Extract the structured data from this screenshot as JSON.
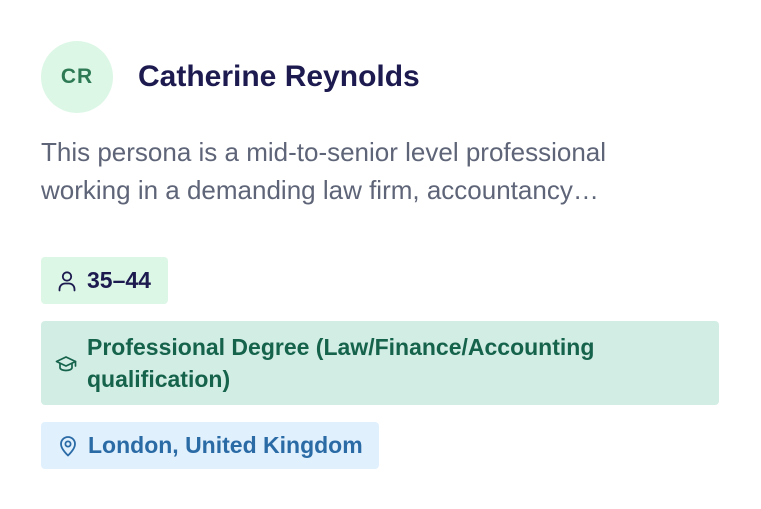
{
  "persona": {
    "initials": "CR",
    "name": "Catherine Reynolds",
    "description": "This persona is a mid-to-senior level professional working in a demanding law firm, accountancy…"
  },
  "tags": {
    "age": "35–44",
    "education": "Professional Degree (Law/Finance/Accounting qualification)",
    "location": "London, United Kingdom"
  },
  "icons": {
    "age": "person-icon",
    "education": "graduation-cap-icon",
    "location": "map-pin-icon"
  },
  "colors": {
    "avatar_bg": "#dcf7e6",
    "avatar_text": "#2e7a55",
    "name": "#1c1a4f",
    "age_tag_bg": "#dcf7e6",
    "education_tag_bg": "#d2ede4",
    "education_tag_text": "#16634c",
    "location_tag_bg": "#e0f0fd",
    "location_tag_text": "#2a6ba6"
  }
}
